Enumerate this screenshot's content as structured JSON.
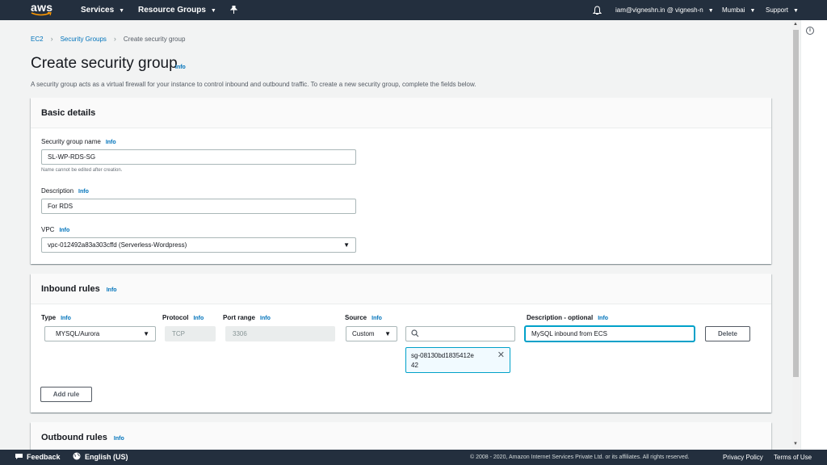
{
  "nav": {
    "logo_text": "aws",
    "services": "Services",
    "resource_groups": "Resource Groups",
    "pin_icon": "pin-icon",
    "bell_icon": "bell-icon",
    "account": "iam@vigneshn.in @ vignesh-n",
    "region": "Mumbai",
    "support": "Support"
  },
  "breadcrumb": {
    "root": "EC2",
    "parent": "Security Groups",
    "current": "Create security group"
  },
  "page": {
    "title": "Create security group",
    "title_info": "Info",
    "description": "A security group acts as a virtual firewall for your instance to control inbound and outbound traffic. To create a new security group, complete the fields below."
  },
  "basic": {
    "header": "Basic details",
    "name_label": "Security group name",
    "name_info": "Info",
    "name_value": "SL-WP-RDS-SG",
    "name_hint": "Name cannot be edited after creation.",
    "desc_label": "Description",
    "desc_info": "Info",
    "desc_value": "For RDS",
    "vpc_label": "VPC",
    "vpc_info": "Info",
    "vpc_value": "vpc-012492a83a303cffd (Serverless-Wordpress)"
  },
  "inbound": {
    "header": "Inbound rules",
    "header_info": "Info",
    "col_type": "Type",
    "col_type_info": "Info",
    "col_protocol": "Protocol",
    "col_protocol_info": "Info",
    "col_port": "Port range",
    "col_port_info": "Info",
    "col_source": "Source",
    "col_source_info": "Info",
    "col_desc": "Description - optional",
    "col_desc_info": "Info",
    "rule": {
      "type": "MYSQL/Aurora",
      "protocol": "TCP",
      "port": "3306",
      "source": "Custom",
      "search_value": "",
      "token_line1": "sg-08130bd1835412e",
      "token_line2": "42",
      "description": "MySQL inbound from ECS",
      "delete": "Delete"
    },
    "add_rule": "Add rule"
  },
  "outbound": {
    "header": "Outbound rules",
    "header_info": "Info"
  },
  "footer": {
    "feedback": "Feedback",
    "language": "English (US)",
    "copyright": "© 2008 - 2020, Amazon Internet Services Private Ltd. or its affiliates. All rights reserved.",
    "privacy": "Privacy Policy",
    "terms": "Terms of Use"
  }
}
